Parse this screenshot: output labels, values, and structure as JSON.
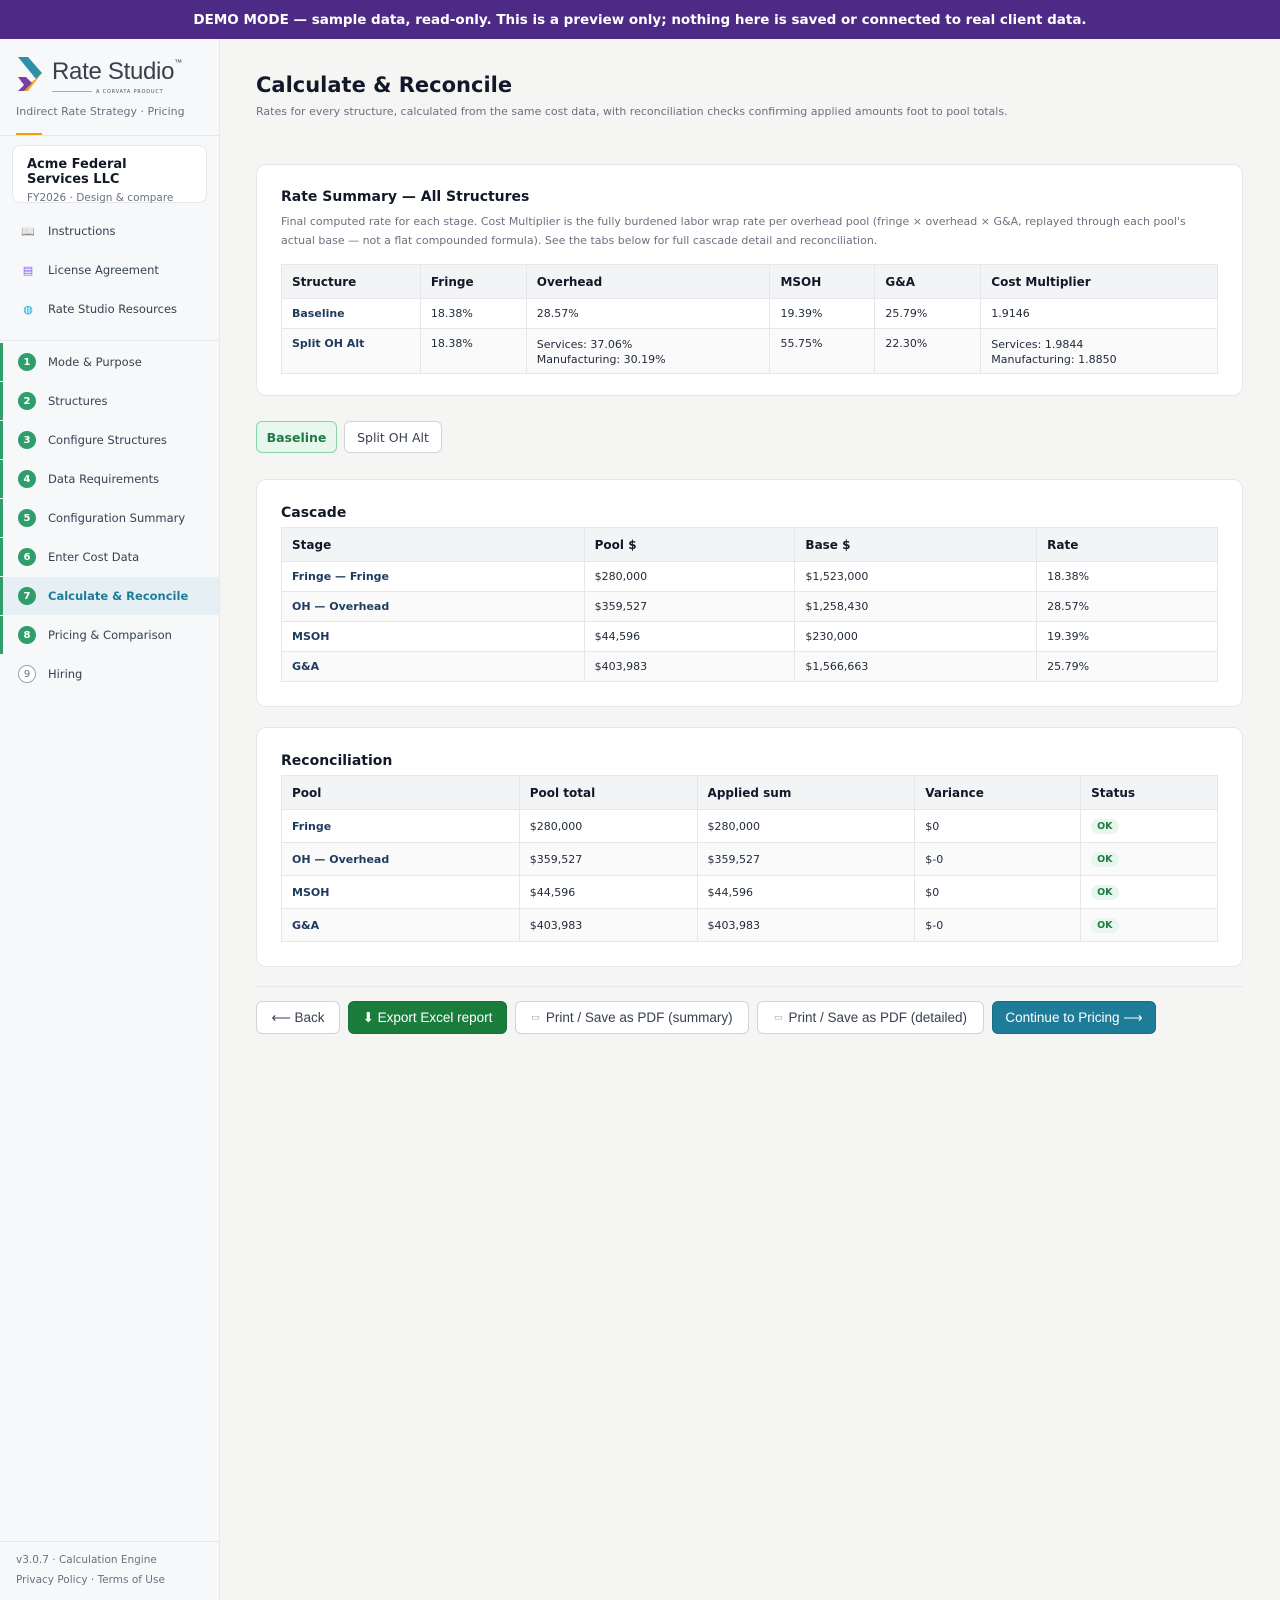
{
  "banner": "DEMO MODE — sample data, read-only. This is a preview only; nothing here is saved or connected to real client data.",
  "brand": {
    "name": "Rate Studio",
    "tm": "™",
    "sub": "A CORVATA PRODUCT",
    "tagline": "Indirect Rate Strategy · Pricing"
  },
  "client": {
    "name": "Acme Federal Services LLC",
    "sub": "FY2026 · Design & compare"
  },
  "resources": [
    {
      "label": "Instructions",
      "icon": "book-icon"
    },
    {
      "label": "License Agreement",
      "icon": "document-icon"
    },
    {
      "label": "Rate Studio Resources",
      "icon": "globe-icon"
    }
  ],
  "steps": [
    {
      "num": "1",
      "label": "Mode & Purpose"
    },
    {
      "num": "2",
      "label": "Structures"
    },
    {
      "num": "3",
      "label": "Configure Structures"
    },
    {
      "num": "4",
      "label": "Data Requirements"
    },
    {
      "num": "5",
      "label": "Configuration Summary"
    },
    {
      "num": "6",
      "label": "Enter Cost Data"
    },
    {
      "num": "7",
      "label": "Calculate & Reconcile"
    },
    {
      "num": "8",
      "label": "Pricing & Comparison"
    },
    {
      "num": "9",
      "label": "Hiring"
    }
  ],
  "footer": {
    "version": "v3.0.7 · Calculation Engine",
    "links": "Privacy Policy · Terms of Use"
  },
  "page": {
    "title": "Calculate & Reconcile",
    "subtitle": "Rates for every structure, calculated from the same cost data, with reconciliation checks confirming applied amounts foot to pool totals."
  },
  "summary": {
    "title": "Rate Summary — All Structures",
    "desc": "Final computed rate for each stage. Cost Multiplier is the fully burdened labor wrap rate per overhead pool (fringe × overhead × G&A, replayed through each pool's actual base — not a flat compounded formula). See the tabs below for full cascade detail and reconciliation.",
    "headers": [
      "Structure",
      "Fringe",
      "Overhead",
      "MSOH",
      "G&A",
      "Cost Multiplier"
    ],
    "rows": [
      {
        "structure": "Baseline",
        "fringe": "18.38%",
        "overhead1": "28.57%",
        "overhead2": "",
        "msoh": "19.39%",
        "ga": "25.79%",
        "mult1": "1.9146",
        "mult2": ""
      },
      {
        "structure": "Split OH Alt",
        "fringe": "18.38%",
        "overhead1": "Services: 37.06%",
        "overhead2": "Manufacturing: 30.19%",
        "msoh": "55.75%",
        "ga": "22.30%",
        "mult1": "Services: 1.9844",
        "mult2": "Manufacturing: 1.8850"
      }
    ]
  },
  "tabs": [
    "Baseline",
    "Split OH Alt"
  ],
  "cascade": {
    "title": "Cascade",
    "headers": [
      "Stage",
      "Pool $",
      "Base $",
      "Rate"
    ],
    "rows": [
      {
        "stage": "Fringe — Fringe",
        "pool": "$280,000",
        "base": "$1,523,000",
        "rate": "18.38%"
      },
      {
        "stage": "OH — Overhead",
        "pool": "$359,527",
        "base": "$1,258,430",
        "rate": "28.57%"
      },
      {
        "stage": "MSOH",
        "pool": "$44,596",
        "base": "$230,000",
        "rate": "19.39%"
      },
      {
        "stage": "G&A",
        "pool": "$403,983",
        "base": "$1,566,663",
        "rate": "25.79%"
      }
    ]
  },
  "reconciliation": {
    "title": "Reconciliation",
    "headers": [
      "Pool",
      "Pool total",
      "Applied sum",
      "Variance",
      "Status"
    ],
    "rows": [
      {
        "pool": "Fringe",
        "total": "$280,000",
        "applied": "$280,000",
        "variance": "$0",
        "status": "OK"
      },
      {
        "pool": "OH — Overhead",
        "total": "$359,527",
        "applied": "$359,527",
        "variance": "$-0",
        "status": "OK"
      },
      {
        "pool": "MSOH",
        "total": "$44,596",
        "applied": "$44,596",
        "variance": "$0",
        "status": "OK"
      },
      {
        "pool": "G&A",
        "total": "$403,983",
        "applied": "$403,983",
        "variance": "$-0",
        "status": "OK"
      }
    ]
  },
  "actions": {
    "back": "⟵ Back",
    "export": "⬇ Export Excel report",
    "pdf_summary": "Print / Save as PDF (summary)",
    "pdf_detailed": "Print / Save as PDF (detailed)",
    "continue": "Continue to Pricing ⟶"
  },
  "colors": {
    "banner": "#4c2a85",
    "accent": "#1e7c99",
    "success": "#2f9e6b",
    "export": "#1a7d3c"
  }
}
